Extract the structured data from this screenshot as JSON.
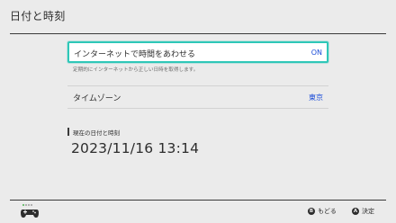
{
  "header": {
    "title": "日付と時刻"
  },
  "settings": {
    "internet_sync": {
      "label": "インターネットで時間をあわせる",
      "value": "ON",
      "hint": "定期的にインターネットから正しい日時を取得します。"
    },
    "timezone": {
      "label": "タイムゾーン",
      "value": "東京"
    }
  },
  "current": {
    "section_label": "現在の日付と時刻",
    "datetime": "2023/11/16 13:14"
  },
  "footer": {
    "back": {
      "button": "B",
      "label": "もどる"
    },
    "ok": {
      "button": "A",
      "label": "決定"
    },
    "controller_icon": "controller-icon"
  },
  "colors": {
    "background": "#ebebeb",
    "focus_border": "#2fc7b8",
    "value_text": "#1d4ed8",
    "controller_led": "#4caf50"
  }
}
